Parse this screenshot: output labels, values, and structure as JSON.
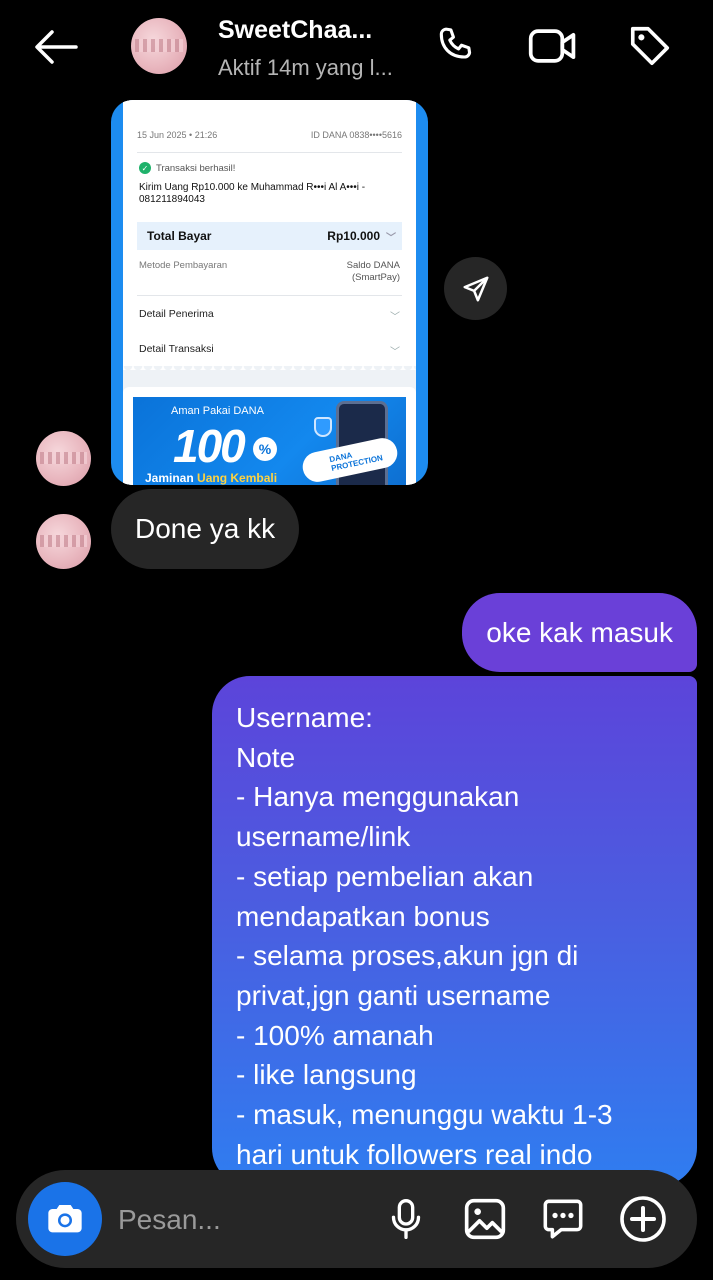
{
  "header": {
    "contact_name": "SweetChaa...",
    "status": "Aktif 14m yang l...",
    "icons": [
      "back-arrow-icon",
      "phone-icon",
      "video-icon",
      "tag-icon"
    ]
  },
  "receipt": {
    "date": "15 Jun 2025 • 21:26",
    "account_id": "ID DANA 0838••••5616",
    "status": "Transaksi berhasil!",
    "description": "Kirim Uang Rp10.000 ke Muhammad R•••i Al A•••i - 081211894043",
    "total_label": "Total Bayar",
    "total_value": "Rp10.000",
    "method_label": "Metode Pembayaran",
    "method_value_1": "Saldo DANA",
    "method_value_2": "(SmartPay)",
    "detail_recipient": "Detail Penerima",
    "detail_transaction": "Detail Transaksi",
    "banner_top": "Aman Pakai DANA",
    "banner_big": "100",
    "banner_pct": "%",
    "banner_bottom_a": "Jaminan ",
    "banner_bottom_b": "Uang Kembali",
    "banner_badge_1": "DANA",
    "banner_badge_2": "PROTECTION"
  },
  "messages": {
    "incoming_1": "Done ya kk",
    "outgoing_1": "oke kak masuk",
    "outgoing_2_lines": [
      "Username:",
      "Note",
      "- Hanya menggunakan",
      "username/link",
      "- setiap pembelian akan",
      "mendapatkan bonus",
      "- selama proses,akun jgn di",
      "privat,jgn ganti username",
      "- 100% amanah",
      "- like langsung",
      "-  masuk, menunggu waktu 1-3",
      "hari untuk followers real indo"
    ]
  },
  "composer": {
    "placeholder": "Pesan...",
    "icons": [
      "camera-icon",
      "microphone-icon",
      "gallery-icon",
      "sticker-icon",
      "plus-icon"
    ]
  },
  "colors": {
    "background": "#000000",
    "incoming_bubble": "#262626",
    "outgoing_bubble": "#6a40d8",
    "camera_button": "#1a73e8"
  }
}
